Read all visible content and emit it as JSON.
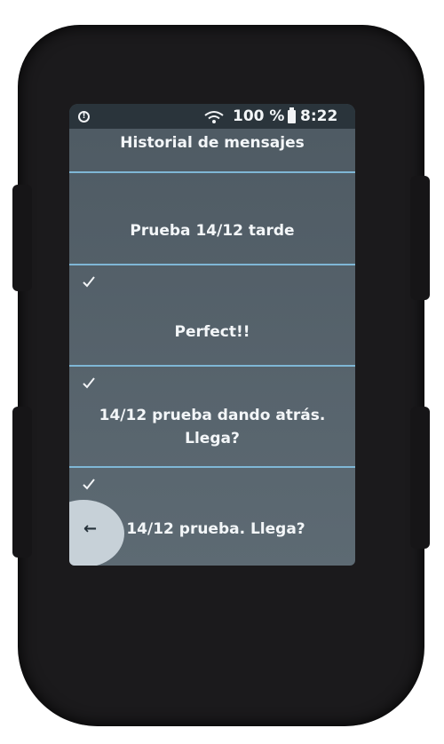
{
  "status_bar": {
    "battery_percent": "100 %",
    "time": "8:22"
  },
  "page_title": "Historial de mensajes",
  "messages": [
    {
      "text": "Prueba 14/12 tarde",
      "delivered": false
    },
    {
      "text": "Perfect!!",
      "delivered": true
    },
    {
      "text": "14/12 prueba dando atrás. Llega?",
      "delivered": true
    },
    {
      "text": "14/12 prueba. Llega?",
      "delivered": true
    }
  ],
  "icons": {
    "info": "info-icon",
    "wifi": "wifi-icon",
    "battery": "battery-icon",
    "check": "check-icon",
    "back": "back-arrow-icon"
  },
  "colors": {
    "screen": "#56626b",
    "divider": "#7fb7d6",
    "text": "#f3f6f8",
    "back_button": "#c7d1d8"
  }
}
